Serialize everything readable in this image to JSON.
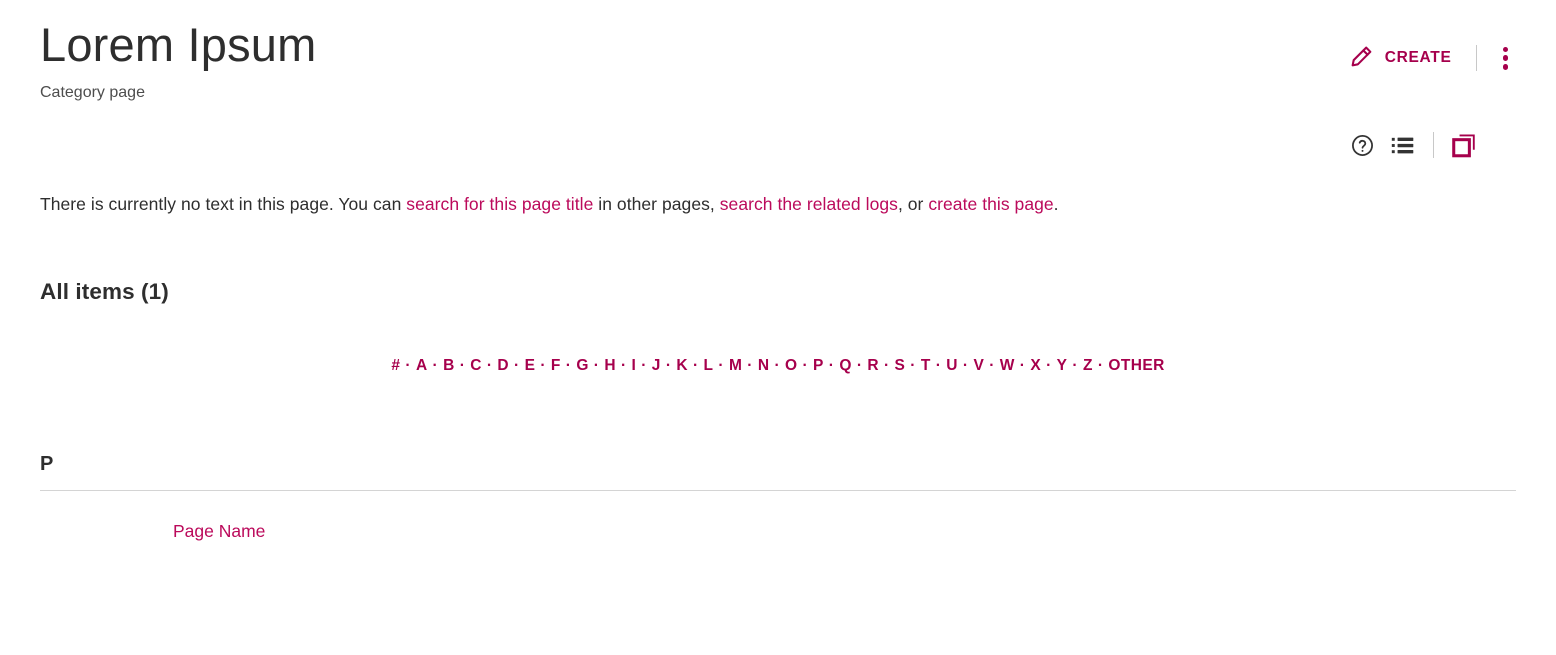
{
  "header": {
    "title": "Lorem Ipsum",
    "subtitle": "Category page",
    "create_label": "CREATE",
    "create_icon": "pencil-icon",
    "menu_icon": "kebab-menu-icon"
  },
  "tools": {
    "help_icon": "help-circle-icon",
    "list_icon": "bulleted-list-icon",
    "copy_icon": "copy-duplicate-icon"
  },
  "intro": {
    "part1": "There is currently no text in this page. You can ",
    "link1": "search for this page title",
    "part2": " in other pages, ",
    "link2": "search the related logs",
    "part3": ", or ",
    "link3": "create this page",
    "part4": "."
  },
  "main": {
    "all_items_heading": "All items (1)",
    "alphabet": [
      "#",
      "A",
      "B",
      "C",
      "D",
      "E",
      "F",
      "G",
      "H",
      "I",
      "J",
      "K",
      "L",
      "M",
      "N",
      "O",
      "P",
      "Q",
      "R",
      "S",
      "T",
      "U",
      "V",
      "W",
      "X",
      "Y",
      "Z",
      "OTHER"
    ],
    "separator": "·",
    "section_letter": "P",
    "items": [
      {
        "label": "Page Name"
      }
    ]
  },
  "colors": {
    "brand_crimson": "#a6004c",
    "link_crimson": "#bb0a5b",
    "text_dark": "#2e2e2e",
    "rule_gray": "#d4d4d4"
  }
}
